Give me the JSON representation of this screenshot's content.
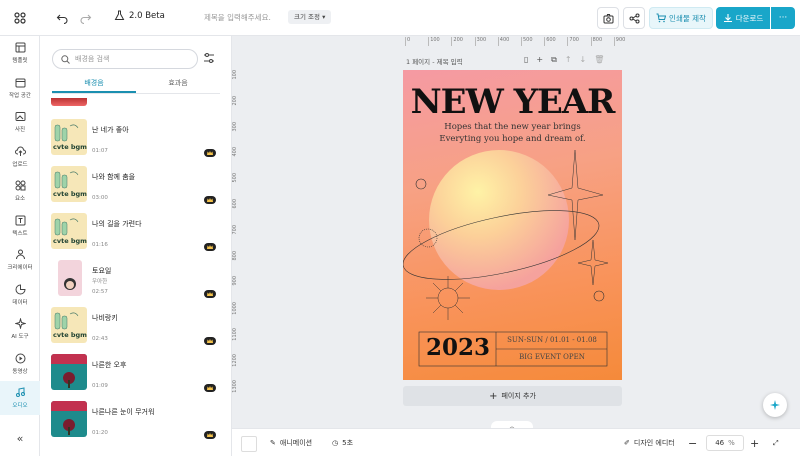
{
  "topbar": {
    "version": "2.0 Beta",
    "title_placeholder": "제목을 입력해주세요.",
    "resize_label": "크기 조정",
    "print_label": "인쇄물 제작",
    "download_label": "다운로드",
    "more_label": "···"
  },
  "rail": [
    {
      "label": "템플릿",
      "icon": "template-icon"
    },
    {
      "label": "작업 공간",
      "icon": "folder-icon"
    },
    {
      "label": "사진",
      "icon": "photo-icon"
    },
    {
      "label": "업로드",
      "icon": "upload-icon"
    },
    {
      "label": "요소",
      "icon": "elements-icon"
    },
    {
      "label": "텍스트",
      "icon": "text-icon"
    },
    {
      "label": "크리에이터",
      "icon": "creator-icon"
    },
    {
      "label": "데이터",
      "icon": "data-icon"
    },
    {
      "label": "AI 도구",
      "icon": "ai-icon"
    },
    {
      "label": "동영상",
      "icon": "video-icon"
    },
    {
      "label": "오디오",
      "icon": "audio-icon"
    }
  ],
  "panel": {
    "search_placeholder": "배경음 검색",
    "tabs": [
      "배경음",
      "효과음"
    ],
    "thumb_text": "cvte bgm",
    "tracks": [
      {
        "title": "난 네가 좋아",
        "artist": "",
        "duration": "01:07",
        "thumb": "bgm"
      },
      {
        "title": "나와 함께 춤을",
        "artist": "",
        "duration": "03:00",
        "thumb": "bgm"
      },
      {
        "title": "나의 길을 가련다",
        "artist": "",
        "duration": "01:16",
        "thumb": "bgm"
      },
      {
        "title": "토요일",
        "artist": "우아한",
        "duration": "02:57",
        "thumb": "photo"
      },
      {
        "title": "나비랑키",
        "artist": "",
        "duration": "02:43",
        "thumb": "bgm"
      },
      {
        "title": "나른한 오후",
        "artist": "",
        "duration": "01:09",
        "thumb": "dark"
      },
      {
        "title": "나른나른 눈이 무거워",
        "artist": "",
        "duration": "01:20",
        "thumb": "dark"
      }
    ]
  },
  "ruler": {
    "h": [
      "0",
      "100",
      "200",
      "300",
      "400",
      "500",
      "600",
      "700",
      "800",
      "900"
    ],
    "v": [
      "100",
      "200",
      "300",
      "400",
      "500",
      "600",
      "700",
      "800",
      "900",
      "1000",
      "1100",
      "1200",
      "1300"
    ]
  },
  "page": {
    "label": "1 페이지 - 제목 입력",
    "add_label": "페이지 추가"
  },
  "poster": {
    "headline": "NEW YEAR",
    "sub1": "Hopes that the new year brings",
    "sub2": "Everyting you hope and dream of.",
    "year": "2023",
    "date": "SUN-SUN / 01.01 - 01.08",
    "event": "BIG EVENT OPEN"
  },
  "bottom": {
    "animation": "애니메이션",
    "duration": "5초",
    "designer": "디자인 에디터",
    "zoom": "46",
    "unit": "%"
  },
  "colors": {
    "accent": "#19a6c9"
  }
}
